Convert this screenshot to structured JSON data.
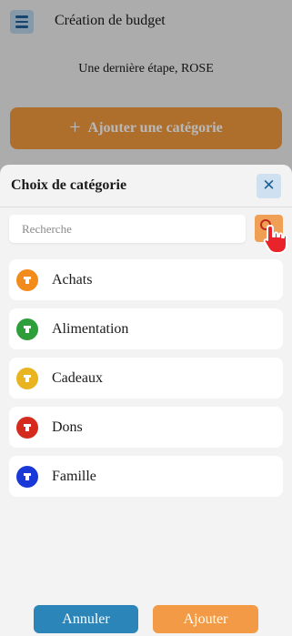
{
  "background": {
    "title": "Création de budget",
    "subtitle": "Une dernière étape, ROSE",
    "add_category_label": "Ajouter une catégorie",
    "plus_icon": "+"
  },
  "sheet": {
    "title": "Choix de catégorie",
    "close_icon": "✕",
    "search": {
      "placeholder": "Recherche",
      "value": ""
    },
    "categories": [
      {
        "label": "Achats",
        "color": "#f28a1c",
        "icon": "category-icon"
      },
      {
        "label": "Alimentation",
        "color": "#2e9e3b",
        "icon": "category-icon"
      },
      {
        "label": "Cadeaux",
        "color": "#e8b41f",
        "icon": "category-icon"
      },
      {
        "label": "Dons",
        "color": "#d42b1e",
        "icon": "category-icon"
      },
      {
        "label": "Famille",
        "color": "#1a38d8",
        "icon": "category-icon"
      }
    ],
    "buttons": {
      "cancel": "Annuler",
      "add": "Ajouter"
    }
  },
  "colors": {
    "primary_blue": "#2b85b8",
    "accent_orange": "#f29a45"
  }
}
